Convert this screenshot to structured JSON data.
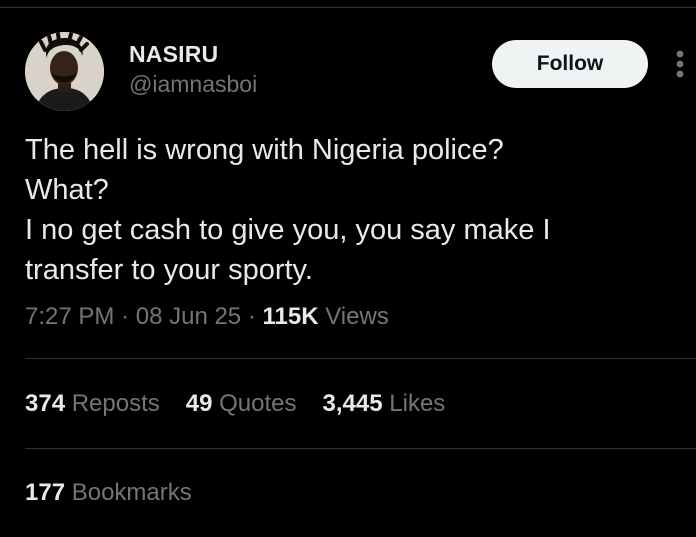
{
  "author": {
    "name": "NASIRU",
    "handle": "@iamnasboi"
  },
  "follow_label": "Follow",
  "more_icon": "more-vertical-icon",
  "tweet": {
    "lines": [
      "The hell is wrong with Nigeria police?",
      "What?",
      "I no get cash to give you, you say make I",
      "transfer to your sporty."
    ]
  },
  "meta": {
    "time": "7:27 PM",
    "separator": "·",
    "date": "08 Jun 25",
    "views_count": "115K",
    "views_label": "Views"
  },
  "stats": {
    "reposts_count": "374",
    "reposts_label": "Reposts",
    "quotes_count": "49",
    "quotes_label": "Quotes",
    "likes_count": "3,445",
    "likes_label": "Likes"
  },
  "bookmarks": {
    "count": "177",
    "label": "Bookmarks"
  },
  "colors": {
    "background": "#000000",
    "primary_text": "#e7e9ea",
    "secondary_text": "#71767b",
    "divider": "#2f3336",
    "follow_bg": "#eff3f4"
  }
}
